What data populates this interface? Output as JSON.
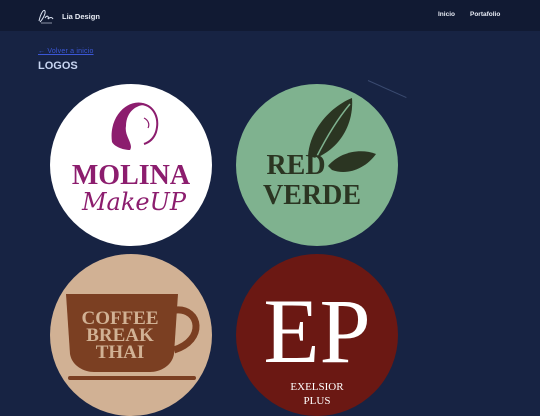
{
  "navbar": {
    "brand_name": "Lia Design",
    "links": [
      "Inicio",
      "Portafolio"
    ]
  },
  "main": {
    "back_link": "← Volver a inicio",
    "section_title": "LOGOS",
    "logos": [
      {
        "name": "Molina MakeUp",
        "line1": "MOLINA",
        "line2": "MakeUP"
      },
      {
        "name": "Red Verde",
        "line1": "RED",
        "line2": "VERDE"
      },
      {
        "name": "Coffee Break Thai",
        "line1": "COFFEE",
        "line2": "BREAK",
        "line3": "THAI"
      },
      {
        "name": "Exelsior Plus",
        "monogram": "EP",
        "line1": "EXELSIOR",
        "line2": "PLUS"
      }
    ]
  },
  "colors": {
    "page_bg": "#172343",
    "navbar_bg": "#111a33",
    "link": "#3b57d6",
    "title": "#c9d6f2"
  }
}
